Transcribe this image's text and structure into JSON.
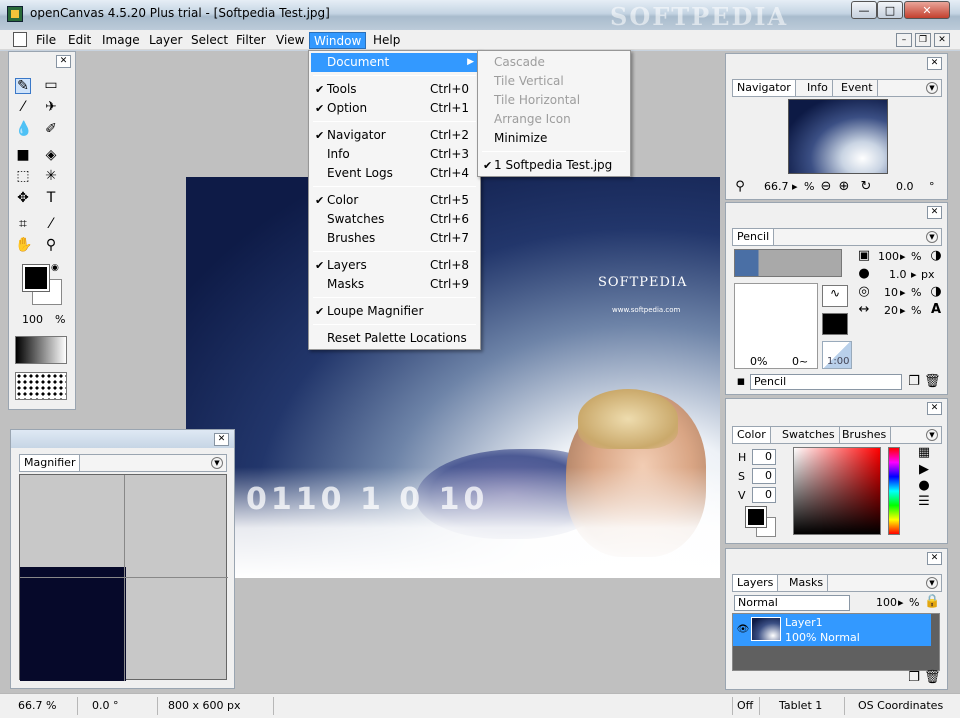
{
  "window": {
    "title": "openCanvas 4.5.20 Plus trial - [Softpedia Test.jpg]",
    "watermark": "SOFTPEDIA",
    "min_glyph": "—",
    "max_glyph": "□",
    "close_glyph": "✕"
  },
  "menubar": {
    "items": [
      "File",
      "Edit",
      "Image",
      "Layer",
      "Select",
      "Filter",
      "View",
      "Window",
      "Help"
    ],
    "active": "Window",
    "mdi": {
      "min": "–",
      "restore": "❐",
      "close": "✕"
    }
  },
  "window_menu": {
    "items": [
      {
        "label": "Document",
        "checked": false,
        "shortcut": "",
        "submenu": true
      },
      {
        "label": "Tools",
        "checked": true,
        "shortcut": "Ctrl+0"
      },
      {
        "label": "Option",
        "checked": true,
        "shortcut": "Ctrl+1"
      },
      {
        "label": "Navigator",
        "checked": true,
        "shortcut": "Ctrl+2"
      },
      {
        "label": "Info",
        "checked": false,
        "shortcut": "Ctrl+3"
      },
      {
        "label": "Event Logs",
        "checked": false,
        "shortcut": "Ctrl+4"
      },
      {
        "label": "Color",
        "checked": true,
        "shortcut": "Ctrl+5"
      },
      {
        "label": "Swatches",
        "checked": false,
        "shortcut": "Ctrl+6"
      },
      {
        "label": "Brushes",
        "checked": false,
        "shortcut": "Ctrl+7"
      },
      {
        "label": "Layers",
        "checked": true,
        "shortcut": "Ctrl+8"
      },
      {
        "label": "Masks",
        "checked": false,
        "shortcut": "Ctrl+9"
      },
      {
        "label": "Loupe Magnifier",
        "checked": true,
        "shortcut": ""
      },
      {
        "label": "Reset Palette Locations",
        "checked": false,
        "shortcut": ""
      }
    ],
    "check_glyph": "✔",
    "arrow_glyph": "▶"
  },
  "document_submenu": {
    "items": [
      {
        "label": "Cascade",
        "disabled": true
      },
      {
        "label": "Tile Vertical",
        "disabled": true
      },
      {
        "label": "Tile Horizontal",
        "disabled": true
      },
      {
        "label": "Arrange Icon",
        "disabled": true
      },
      {
        "label": "Minimize",
        "disabled": false
      },
      {
        "label": "1 Softpedia Test.jpg",
        "disabled": false,
        "checked": true
      }
    ]
  },
  "tools_palette": {
    "zoom_value": "100",
    "zoom_unit": "%",
    "icons": [
      "pencil-icon",
      "eraser-icon",
      "brush-icon",
      "airbrush-icon",
      "water-icon",
      "marker-icon",
      "fill-rect-icon",
      "bucket-icon",
      "select-rect-icon",
      "magic-wand-icon",
      "move-icon",
      "text-icon",
      "crop-icon",
      "eyedropper-icon",
      "hand-icon",
      "zoom-icon"
    ]
  },
  "magnifier": {
    "tab": "Magnifier"
  },
  "navigator_palette": {
    "tabs": [
      "Navigator",
      "Info",
      "Event"
    ],
    "zoom": "66.7",
    "zoom_unit": "%",
    "rotation": "0.0",
    "rotation_unit": "°"
  },
  "pencil_palette": {
    "tab": "Pencil",
    "opacity": "100",
    "opacity_unit": "%",
    "size": "1.0",
    "size_unit": "px",
    "density": "10",
    "density_unit": "%",
    "spacing": "20",
    "spacing_unit": "%",
    "preview_left": "0%",
    "preview_right": "0~",
    "ratio": "1:00",
    "preset_name": "Pencil"
  },
  "color_palette": {
    "tabs": [
      "Color",
      "Swatches",
      "Brushes"
    ],
    "h_label": "H",
    "h_value": "0",
    "s_label": "S",
    "s_value": "0",
    "v_label": "V",
    "v_value": "0",
    "hue_color": "#ff0000"
  },
  "layers_palette": {
    "tabs": [
      "Layers",
      "Masks"
    ],
    "blend_mode": "Normal",
    "opacity": "100",
    "opacity_unit": "%",
    "layer_name": "Layer1",
    "layer_info": "100% Normal"
  },
  "canvas": {
    "brand": "SOFTPEDIA",
    "url": "www.softpedia.com",
    "digits": "0110 1 0 10"
  },
  "statusbar": {
    "zoom": "66.7 %",
    "angle": "0.0 °",
    "size": "800 x 600 px",
    "off": "Off",
    "tablet": "Tablet 1",
    "coords": "OS Coordinates"
  }
}
